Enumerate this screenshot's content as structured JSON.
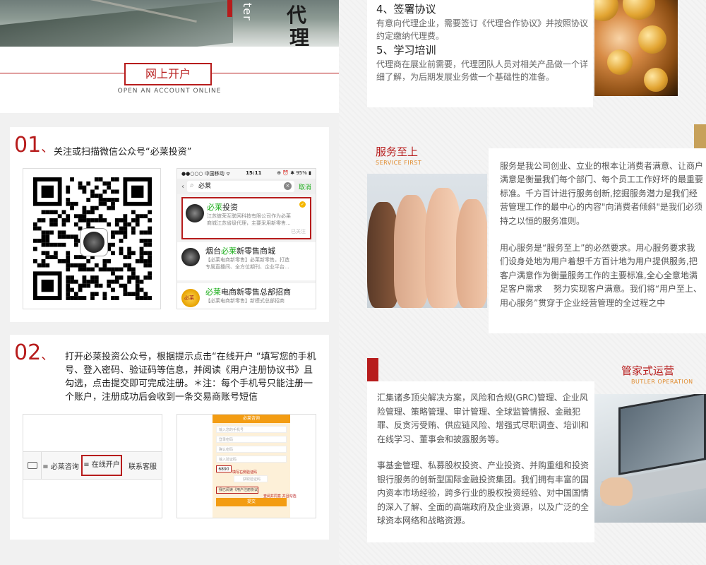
{
  "hero": {
    "side_text": "ter",
    "char1": "代",
    "char2": "理"
  },
  "open_account": {
    "title": "网上开户",
    "subtitle": "OPEN AN ACCOUNT ONLINE"
  },
  "step1": {
    "number": "01",
    "separator": "、",
    "text": "关注或扫描微信公众号“必莱投资”",
    "phone": {
      "carrier": "●●○○○ 中国移动 ᯤ",
      "time": "15:11",
      "battery": "⊕ ⏰ ✱ 95% ▮",
      "search_value": "必莱",
      "cancel": "取消",
      "results": [
        {
          "name_green": "必莱",
          "name_rest": "投资",
          "desc": "江苏彼荣互联网科技有限公司作为必莱",
          "desc2": "商城江苏省级代理，主要采用新零售...",
          "tag": "已关注"
        },
        {
          "name_pre": "烟台",
          "name_green": "必莱",
          "name_rest": "新零售商城",
          "desc": "【必莱电商新零售】必莱新零售。打造",
          "desc2": "专属直播间、全方位期刊、企业平台..."
        },
        {
          "name_green": "必莱",
          "name_rest": "电商新零售总部招商",
          "desc": "【必莱电商新零售】新模式总部招商",
          "badge": "必莱"
        }
      ]
    }
  },
  "step2": {
    "number": "02",
    "separator": "、",
    "text": "打开必莱投资公众号，根据提示点击“在线开户 “填写您的手机号、登入密码、验证码等信息，并阅读《用户注册协议书》且勾选，点击提交即可完成注册。＊注：每个手机号只能注册一个账户，注册成功后会收到一条交易商账号短信",
    "menu": [
      "必莱咨询",
      "在线开户",
      "联系客服"
    ],
    "form": {
      "header": "必莱咨询",
      "fields": [
        "输入您的手机号",
        "登录密码",
        "确认密码",
        "输入验证码"
      ],
      "code": "6890",
      "code_note": "填写右侧验证码",
      "btn_sms": "获取验证码",
      "agree": "我已阅读《用户注册协议书》",
      "agree_note": "查阅并同意 并且勾选",
      "submit": "提交"
    }
  },
  "agent": {
    "h4": "4、签署协议",
    "p4": "有意向代理企业，需要签订《代理合作协议》并按照协议约定缴纳代理费。",
    "h5": "5、学习培训",
    "p5": "代理商在展业前需要，代理团队人员对相关产品做一个详细了解，为后期发展业务做一个基础性的准备。"
  },
  "service": {
    "title": "服务至上",
    "subtitle": "SERVICE FIRST",
    "p1": "服务是我公司创业、立业的根本让消费者满意、让商户满意是衡量我们每个部门、每个员工工作好坏的最重要标准。千方百计进行服务创新,挖掘服务潜力是我们经营管理工作的最中心的内容\"向消费者倾斜\"是我们必须持之以恒的服务准则。",
    "p2": "用心服务是“服务至上”的必然要求。用心服务要求我们设身处地为用户着想千方百计地为用户提供服务,把客户满意作为衡量服务工作的主要标准,全心全意地满足客户需求　 努力实现客户满意。我们将“用户至上、用心服务”贯穿于企业经营管理的全过程之中"
  },
  "butler": {
    "title": "管家式运营",
    "subtitle": "BUTLER OPERATION",
    "p1": "汇集诸多顶尖解决方案，风险和合规(GRC)管理、企业风险管理、策略管理、审计管理、全球监管情报、金融犯罪、反贪污受贿、供应链风险、增强式尽职调查、培训和在线学习、董事会和披露服务等。",
    "p2": "事基金管理、私募股权投资、产业投资、并购重组和投资银行服务的创新型国际金融投资集团。我们拥有丰富的国内资本市场经验，跨多行业的股权投资经验、对中国国情的深入了解、全面的高端政府及企业资源，以及广泛的全球资本网络和战略资源。"
  },
  "colors": {
    "brand_red": "#b71c1c",
    "accent_orange": "#e08a2b",
    "wechat_green": "#1aad19",
    "gold": "#c7a15a"
  }
}
